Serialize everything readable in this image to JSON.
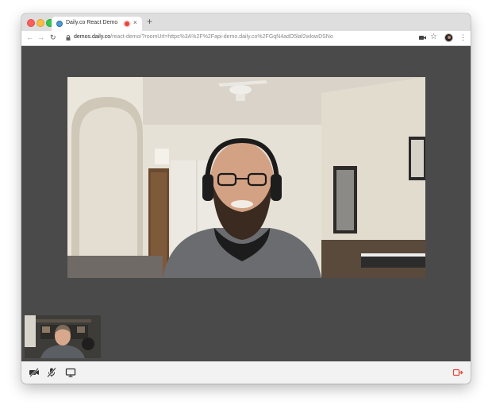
{
  "browser": {
    "tab": {
      "title": "Daily.co React Demo",
      "close_glyph": "×",
      "favicon": "daily-favicon",
      "recording_indicator_color": "#e8453c"
    },
    "new_tab_glyph": "+",
    "nav": {
      "back_glyph": "←",
      "forward_glyph": "→",
      "reload_glyph": "↻"
    },
    "address": {
      "host": "demos.daily.co",
      "path": "/react-demo/?roomUrl=https%3A%2F%2Fapi-demo.daily.co%2FGqN4adO5laf2wlowDSNo"
    },
    "toolbar": {
      "camera_indicator": "camera-in-use-icon",
      "star_glyph": "☆",
      "menu_glyph": "⋮",
      "profile": "avatar"
    }
  },
  "call": {
    "main_participant": "remote participant video",
    "local_participant": "local participant video",
    "tray": {
      "camera": "camera-off-icon",
      "mic": "mic-off-icon",
      "screenshare": "screenshare-icon",
      "leave": "leave-call-icon",
      "leave_color": "#e5473c"
    }
  },
  "colors": {
    "call_background": "#4a4a4a",
    "tray_background": "#f2f2f2",
    "tab_strip": "#dedede"
  }
}
